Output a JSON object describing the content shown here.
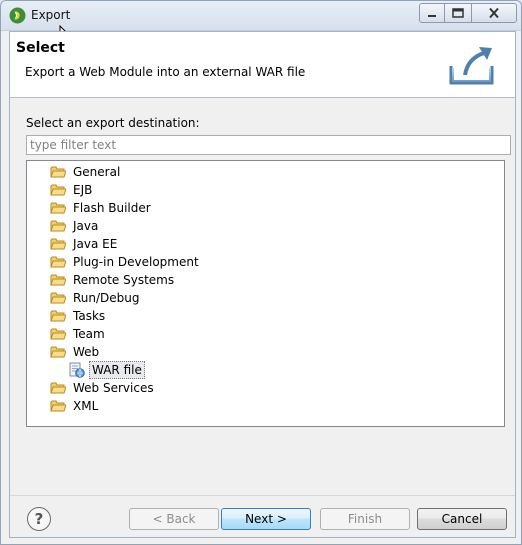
{
  "window": {
    "title": "Export"
  },
  "header": {
    "title": "Select",
    "description": "Export a Web Module into an external WAR file"
  },
  "destination": {
    "label": "Select an export destination:",
    "filter_placeholder": "type filter text",
    "filter_value": ""
  },
  "tree": {
    "items": [
      {
        "label": "General",
        "icon": "folder-icon"
      },
      {
        "label": "EJB",
        "icon": "folder-icon"
      },
      {
        "label": "Flash Builder",
        "icon": "folder-icon"
      },
      {
        "label": "Java",
        "icon": "folder-icon"
      },
      {
        "label": "Java EE",
        "icon": "folder-icon"
      },
      {
        "label": "Plug-in Development",
        "icon": "folder-icon"
      },
      {
        "label": "Remote Systems",
        "icon": "folder-icon"
      },
      {
        "label": "Run/Debug",
        "icon": "folder-icon"
      },
      {
        "label": "Tasks",
        "icon": "folder-icon"
      },
      {
        "label": "Team",
        "icon": "folder-icon"
      },
      {
        "label": "Web",
        "icon": "folder-open-icon"
      },
      {
        "label": "WAR file",
        "icon": "war-file-icon",
        "selected": true
      },
      {
        "label": "Web Services",
        "icon": "folder-icon"
      },
      {
        "label": "XML",
        "icon": "folder-icon"
      }
    ]
  },
  "buttons": {
    "back": "< Back",
    "next": "Next >",
    "finish": "Finish",
    "cancel": "Cancel",
    "help": "?"
  },
  "colors": {
    "folder": "#e8b84a",
    "selection": "#e8eaed",
    "default_button_border": "#3c7fb1"
  }
}
